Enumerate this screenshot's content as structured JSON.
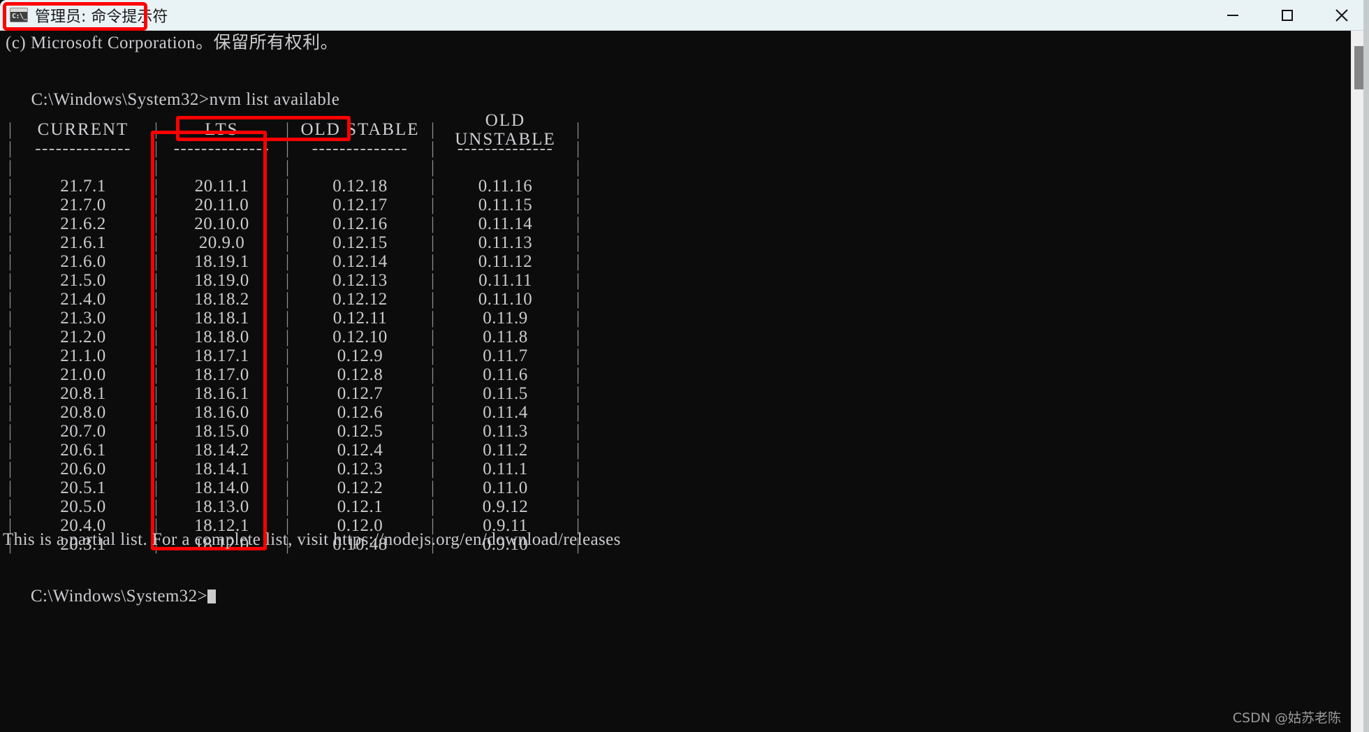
{
  "window": {
    "title": "管理员: 命令提示符",
    "icon": "cmd-prompt-icon",
    "controls": {
      "minimize": "minimize-button",
      "maximize": "maximize-button",
      "close": "close-button"
    },
    "titlebar_bg": "#e9f2f5",
    "highlight_color": "#fe0000"
  },
  "terminal": {
    "bg": "#0c0c0c",
    "fg": "#ccccd0",
    "copyright_line": "(c) Microsoft Corporation。保留所有权利。",
    "prompt": "C:\\Windows\\System32>",
    "command": "nvm list available",
    "partial_note": "This is a partial list. For a complete list, visit https://nodejs.org/en/download/releases",
    "final_prompt": "C:\\Windows\\System32>"
  },
  "table_data": {
    "type": "table",
    "columns": [
      "CURRENT",
      "LTS",
      "OLD STABLE",
      "OLD UNSTABLE"
    ],
    "separator": "|",
    "dash_rule": "--------------",
    "rows": [
      [
        "21.7.1",
        "20.11.1",
        "0.12.18",
        "0.11.16"
      ],
      [
        "21.7.0",
        "20.11.0",
        "0.12.17",
        "0.11.15"
      ],
      [
        "21.6.2",
        "20.10.0",
        "0.12.16",
        "0.11.14"
      ],
      [
        "21.6.1",
        "20.9.0",
        "0.12.15",
        "0.11.13"
      ],
      [
        "21.6.0",
        "18.19.1",
        "0.12.14",
        "0.11.12"
      ],
      [
        "21.5.0",
        "18.19.0",
        "0.12.13",
        "0.11.11"
      ],
      [
        "21.4.0",
        "18.18.2",
        "0.12.12",
        "0.11.10"
      ],
      [
        "21.3.0",
        "18.18.1",
        "0.12.11",
        "0.11.9"
      ],
      [
        "21.2.0",
        "18.18.0",
        "0.12.10",
        "0.11.8"
      ],
      [
        "21.1.0",
        "18.17.1",
        "0.12.9",
        "0.11.7"
      ],
      [
        "21.0.0",
        "18.17.0",
        "0.12.8",
        "0.11.6"
      ],
      [
        "20.8.1",
        "18.16.1",
        "0.12.7",
        "0.11.5"
      ],
      [
        "20.8.0",
        "18.16.0",
        "0.12.6",
        "0.11.4"
      ],
      [
        "20.7.0",
        "18.15.0",
        "0.12.5",
        "0.11.3"
      ],
      [
        "20.6.1",
        "18.14.2",
        "0.12.4",
        "0.11.2"
      ],
      [
        "20.6.0",
        "18.14.1",
        "0.12.3",
        "0.11.1"
      ],
      [
        "20.5.1",
        "18.14.0",
        "0.12.2",
        "0.11.0"
      ],
      [
        "20.5.0",
        "18.13.0",
        "0.12.1",
        "0.9.12"
      ],
      [
        "20.4.0",
        "18.12.1",
        "0.12.0",
        "0.9.11"
      ],
      [
        "20.3.1",
        "18.12.0",
        "0.10.48",
        "0.9.10"
      ]
    ]
  },
  "highlights": [
    {
      "name": "title-highlight",
      "target": "管理员: 命令提示符"
    },
    {
      "name": "command-highlight",
      "target": "nvm list available"
    },
    {
      "name": "lts-column-highlight",
      "target": "LTS"
    }
  ],
  "scrollbar": {
    "name": "vertical-scrollbar",
    "thumb_position_pct": 4
  },
  "watermark": {
    "text": "CSDN @姑苏老陈"
  }
}
